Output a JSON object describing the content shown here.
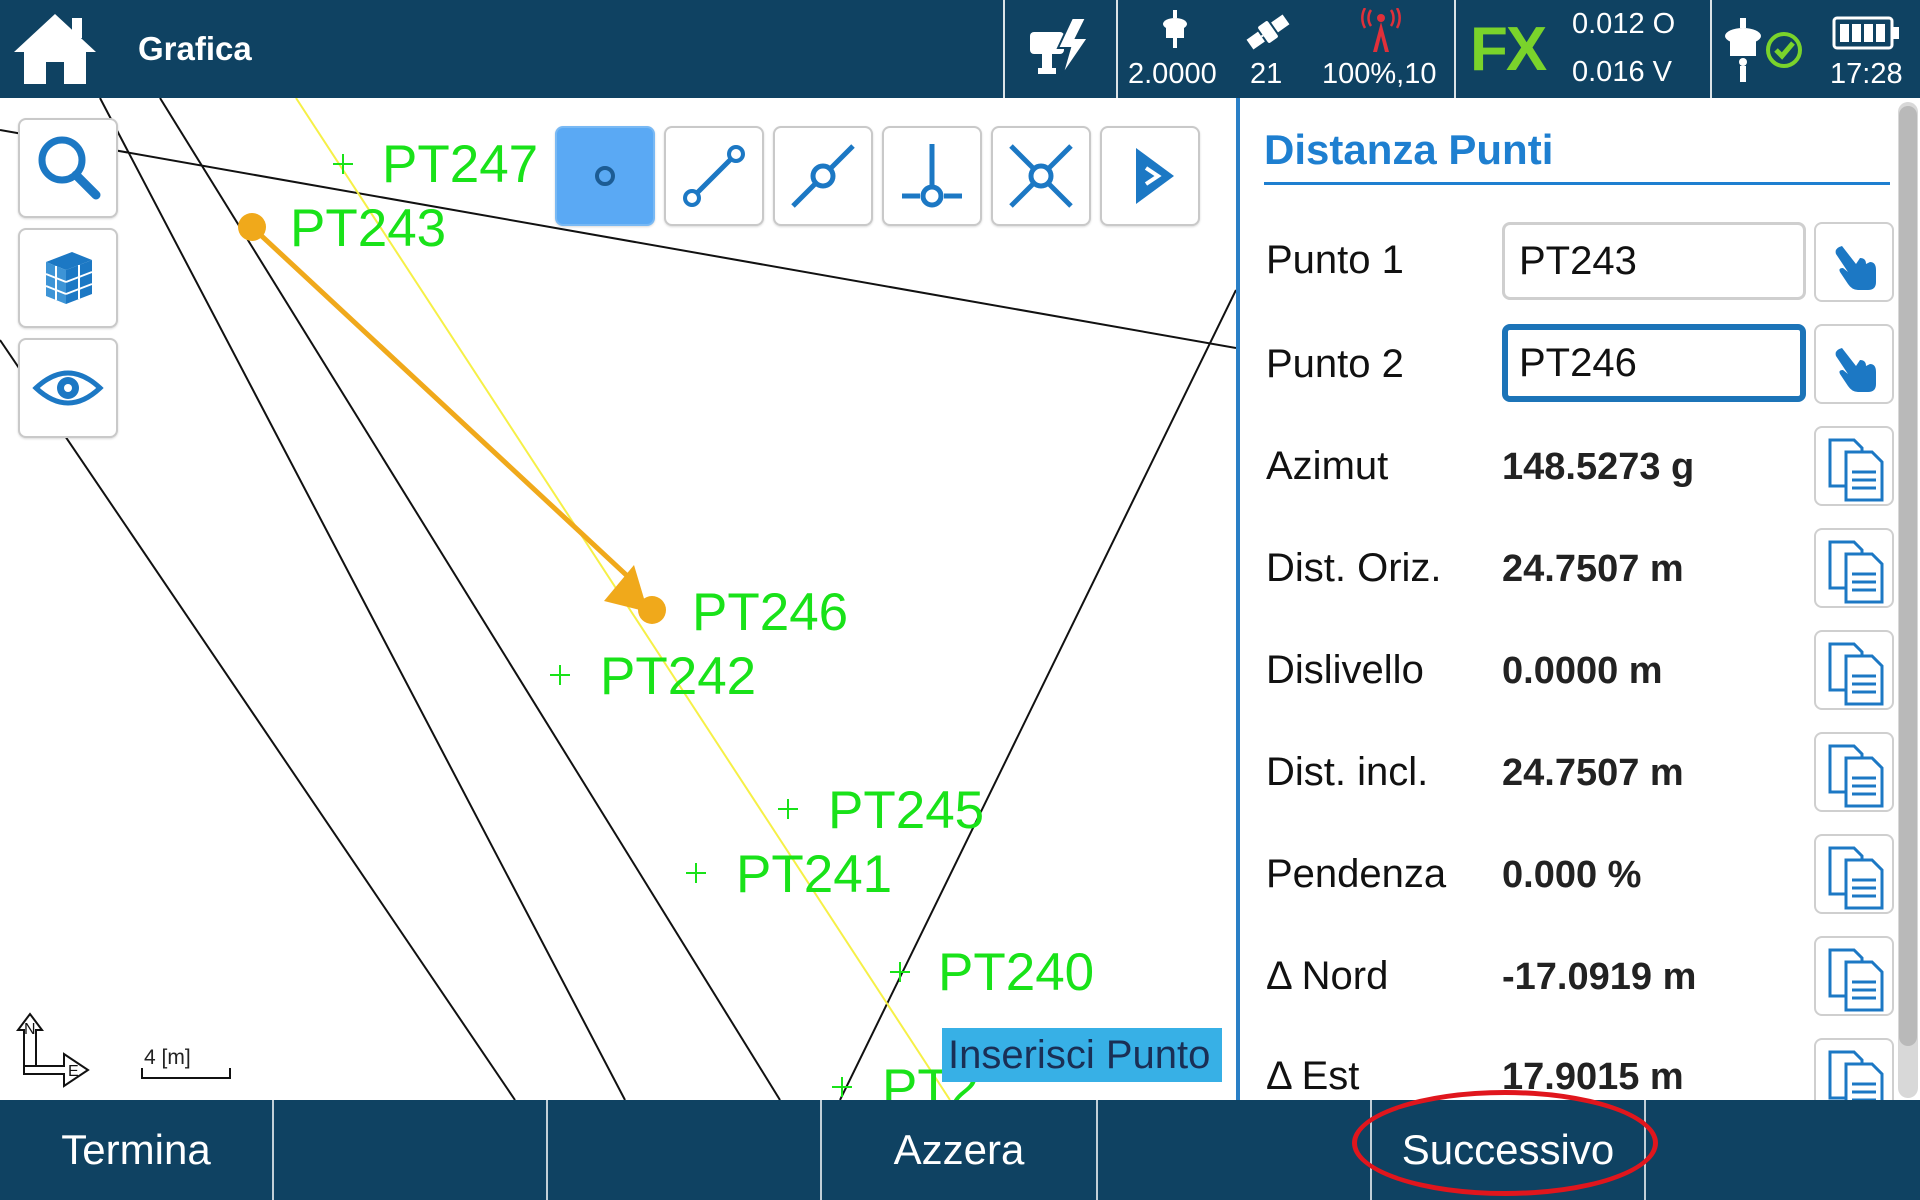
{
  "app": {
    "title": "Grafica"
  },
  "status": {
    "antenna_height": "2.0000",
    "satellites": "21",
    "signal": "100%,10",
    "fix_type": "FX",
    "precision_h": "0.012 O",
    "precision_v": "0.016 V",
    "time": "17:28"
  },
  "toolbar": {
    "tools": [
      "point-tool",
      "line-tool",
      "line-point-tool",
      "perpendicular-tool",
      "intersection-tool",
      "next-tool"
    ],
    "active_tool": "point-tool"
  },
  "map": {
    "points": [
      "PT247",
      "PT243",
      "PT246",
      "PT242",
      "PT245",
      "PT241",
      "PT240"
    ],
    "cut_label": "PT2",
    "insert_hint": "Inserisci Punto",
    "scale_label": "4 [m]",
    "north_label": "N",
    "east_label": "E"
  },
  "panel": {
    "title": "Distanza Punti",
    "punto1": {
      "label": "Punto 1",
      "value": "PT243"
    },
    "punto2": {
      "label": "Punto 2",
      "value": "PT246"
    },
    "rows": [
      {
        "label": "Azimut",
        "value": "148.5273 g"
      },
      {
        "label": "Dist. Oriz.",
        "value": "24.7507 m"
      },
      {
        "label": "Dislivello",
        "value": "0.0000 m"
      },
      {
        "label": "Dist. incl.",
        "value": "24.7507 m"
      },
      {
        "label": "Pendenza",
        "value": "0.000 %"
      },
      {
        "label": "Δ Nord",
        "value": "-17.0919 m"
      },
      {
        "label": "Δ Est",
        "value": "17.9015 m"
      }
    ]
  },
  "bottom": {
    "termina": "Termina",
    "azzera": "Azzera",
    "successivo": "Successivo"
  },
  "colors": {
    "bar": "#0f4262",
    "point_label": "#19e219",
    "arrow": "#f0a91b",
    "panel_accent": "#1e7fd0",
    "fix_green": "#7ad32b"
  }
}
